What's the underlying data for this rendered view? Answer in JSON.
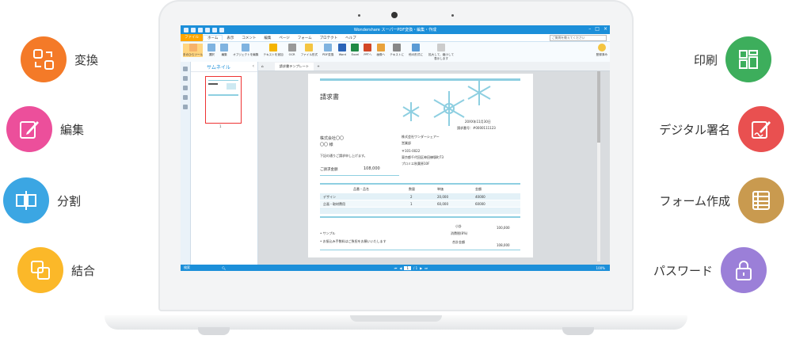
{
  "features_left": [
    {
      "label": "変換",
      "icon": "convert-icon",
      "color": "#f47a28"
    },
    {
      "label": "編集",
      "icon": "edit-icon",
      "color": "#ec4f9b"
    },
    {
      "label": "分割",
      "icon": "split-icon",
      "color": "#3ba6e3"
    },
    {
      "label": "結合",
      "icon": "merge-icon",
      "color": "#fbb829"
    }
  ],
  "features_right": [
    {
      "label": "印刷",
      "icon": "print-icon",
      "color": "#3dae5c"
    },
    {
      "label": "デジタル署名",
      "icon": "signature-icon",
      "color": "#e95050"
    },
    {
      "label": "フォーム作成",
      "icon": "form-icon",
      "color": "#c99a4f"
    },
    {
      "label": "パスワード",
      "icon": "lock-icon",
      "color": "#9b7fd8"
    }
  ],
  "app": {
    "title": "Wondershare スーパーPDF変換・編集・作成",
    "menu": [
      "ファイル",
      "ホーム",
      "表示",
      "コメント",
      "編集",
      "ページ",
      "フォーム",
      "プロテクト",
      "ヘルプ"
    ],
    "active_menu": "ホーム",
    "help_search_placeholder": "ご質問を教えてください",
    "ribbon": [
      "手のひらツール",
      "選択",
      "編集",
      "オブジェクトを編集",
      "テキストを追加",
      "OCR",
      "ファイル形式",
      "PDF変換",
      "Word",
      "Excel",
      "PPTへ",
      "画像へ",
      "テキストに",
      "他の形式に",
      "拡大して、縮小して表示します",
      "登録済み"
    ],
    "thumb_title": "サムネイル",
    "thumb_page_num": "1",
    "doc_tab": "請求書テンプレート",
    "status_left": "検索",
    "page_current": "1",
    "page_total": "/ 1",
    "zoom": "100%"
  },
  "invoice": {
    "title": "請求書",
    "date": "20XX年11月30日",
    "number": "請求番号：#0000111123",
    "to_company": "株式会社〇〇",
    "to_person": "〇〇 様",
    "note": "下記の通りご請求申し上げます。",
    "amount_label": "ご請求金額",
    "amount_value": "108,000",
    "from_company": "株式会社ワンダーシェアー",
    "from_person": "営業部",
    "from_zip": "〒101-0022",
    "from_addr1": "東京都千代田区神田練塀町73",
    "from_addr2": "プロミエ秋葉原10F",
    "headers": [
      "品番・品名",
      "数量",
      "単価",
      "金額"
    ],
    "rows": [
      [
        "デザイン",
        "2",
        "20,000",
        "40000"
      ],
      [
        "企画・取材費用",
        "1",
        "60,000",
        "60000"
      ]
    ],
    "subtotal_label": "小計",
    "subtotal_value": "100,000",
    "tax_label": "消費税(8%)",
    "total_label": "合計金額",
    "total_value": "108,000",
    "bullet1": "サンプル",
    "bullet2": "お振込み手数料はご負担をお願いいたします"
  }
}
